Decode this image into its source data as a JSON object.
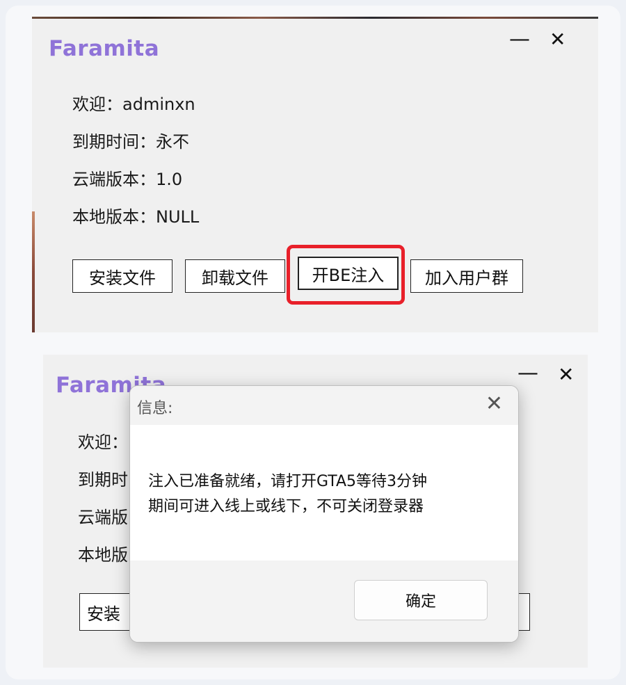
{
  "top": {
    "logo": "Faramita",
    "minimize": "—",
    "close": "✕",
    "welcome": "欢迎：adminxn",
    "expiry": "到期时间：永不",
    "cloud_version": "云端版本：1.0",
    "local_version": "本地版本：NULL",
    "buttons": {
      "install": "安装文件",
      "uninstall": "卸载文件",
      "inject": "开BE注入",
      "join_group": "加入用户群"
    },
    "highlight_color": "#e8202a"
  },
  "bottom": {
    "logo": "Faramita",
    "minimize": "—",
    "close": "✕",
    "welcome_partial": "欢迎：",
    "expiry_partial": "到期时",
    "cloud_partial": "云端版",
    "local_partial": "本地版",
    "install_partial": "安装",
    "dialog": {
      "title": "信息:",
      "close": "✕",
      "message_line1": "注入已准备就绪，请打开GTA5等待3分钟",
      "message_line2": "期间可进入线上或线下，不可关闭登录器",
      "ok": "确定"
    }
  },
  "colors": {
    "logo": "#8f73d8",
    "accent_red": "#e8202a"
  }
}
